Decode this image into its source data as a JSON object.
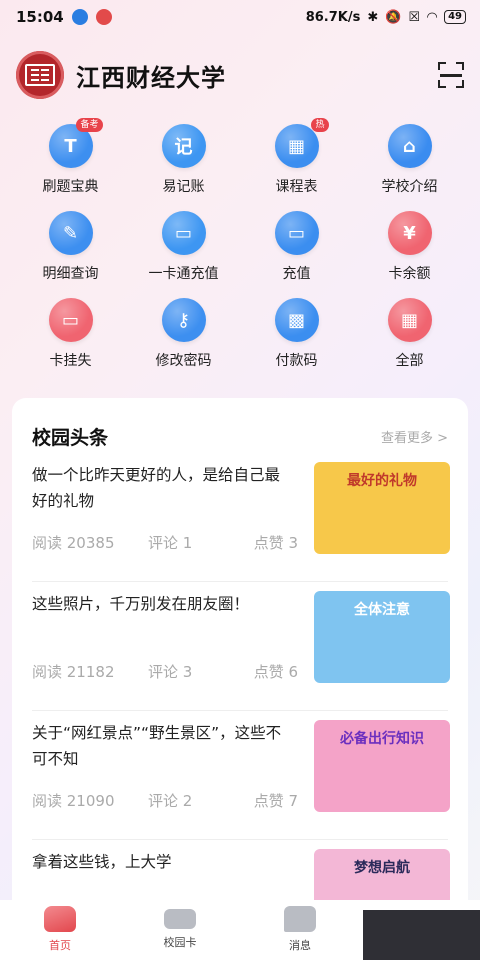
{
  "status_bar": {
    "time": "15:04",
    "network_speed": "86.7K/s",
    "battery": "49"
  },
  "header": {
    "title": "江西财经大学"
  },
  "grid": [
    {
      "label": "刷题宝典",
      "icon": "exam-book-icon",
      "badge": "备考",
      "color": "#3d8ff0",
      "glyph": "T"
    },
    {
      "label": "易记账",
      "icon": "ledger-icon",
      "badge": "",
      "color": "#3d96f2",
      "glyph": "记"
    },
    {
      "label": "课程表",
      "icon": "timetable-icon",
      "badge": "热",
      "color": "#3b8ef0",
      "glyph": "▦"
    },
    {
      "label": "学校介绍",
      "icon": "school-icon",
      "badge": "",
      "color": "#3a8cf0",
      "glyph": "⌂"
    },
    {
      "label": "明细查询",
      "icon": "detail-query-icon",
      "badge": "",
      "color": "#3d8ff0",
      "glyph": "✎"
    },
    {
      "label": "一卡通充值",
      "icon": "card-recharge-icon",
      "badge": "",
      "color": "#3d96f2",
      "glyph": "▭"
    },
    {
      "label": "充值",
      "icon": "recharge-icon",
      "badge": "",
      "color": "#3b8ef0",
      "glyph": "▭"
    },
    {
      "label": "卡余额",
      "icon": "balance-icon",
      "badge": "",
      "color": "#f06470",
      "glyph": "¥"
    },
    {
      "label": "卡挂失",
      "icon": "card-loss-icon",
      "badge": "",
      "color": "#f06470",
      "glyph": "▭"
    },
    {
      "label": "修改密码",
      "icon": "key-icon",
      "badge": "",
      "color": "#3d8ff0",
      "glyph": "⚷"
    },
    {
      "label": "付款码",
      "icon": "qr-code-icon",
      "badge": "",
      "color": "#3b8ef0",
      "glyph": "▩"
    },
    {
      "label": "全部",
      "icon": "all-apps-icon",
      "badge": "",
      "color": "#f06470",
      "glyph": "▦"
    }
  ],
  "news_section": {
    "title": "校园头条",
    "more": "查看更多 >",
    "items": [
      {
        "title": "做一个比昨天更好的人，是给自己最好的礼物",
        "reads": "阅读 20385",
        "comments": "评论 1",
        "likes": "点赞 3",
        "thumb_text": "最好的礼物",
        "thumb_bg": "#f7c84a",
        "thumb_fg": "#c0392b"
      },
      {
        "title": "这些照片，千万别发在朋友圈！",
        "reads": "阅读 21182",
        "comments": "评论 3",
        "likes": "点赞 6",
        "thumb_text": "全体注意",
        "thumb_bg": "#7fc4f0",
        "thumb_fg": "#ffffff"
      },
      {
        "title": "关于“网红景点”“野生景区”，这些不可不知",
        "reads": "阅读 21090",
        "comments": "评论 2",
        "likes": "点赞 7",
        "thumb_text": "必备出行知识",
        "thumb_bg": "#f4a3c8",
        "thumb_fg": "#6b2fbf"
      },
      {
        "title": "拿着这些钱，上大学",
        "reads": "",
        "comments": "",
        "likes": "",
        "thumb_text": "梦想启航",
        "thumb_bg": "#f3b7d6",
        "thumb_fg": "#2a2a5a"
      }
    ]
  },
  "tabbar": {
    "tabs": [
      {
        "label": "首页",
        "icon": "home-icon"
      },
      {
        "label": "校园卡",
        "icon": "campus-card-icon"
      },
      {
        "label": "消息",
        "icon": "message-icon"
      }
    ]
  }
}
